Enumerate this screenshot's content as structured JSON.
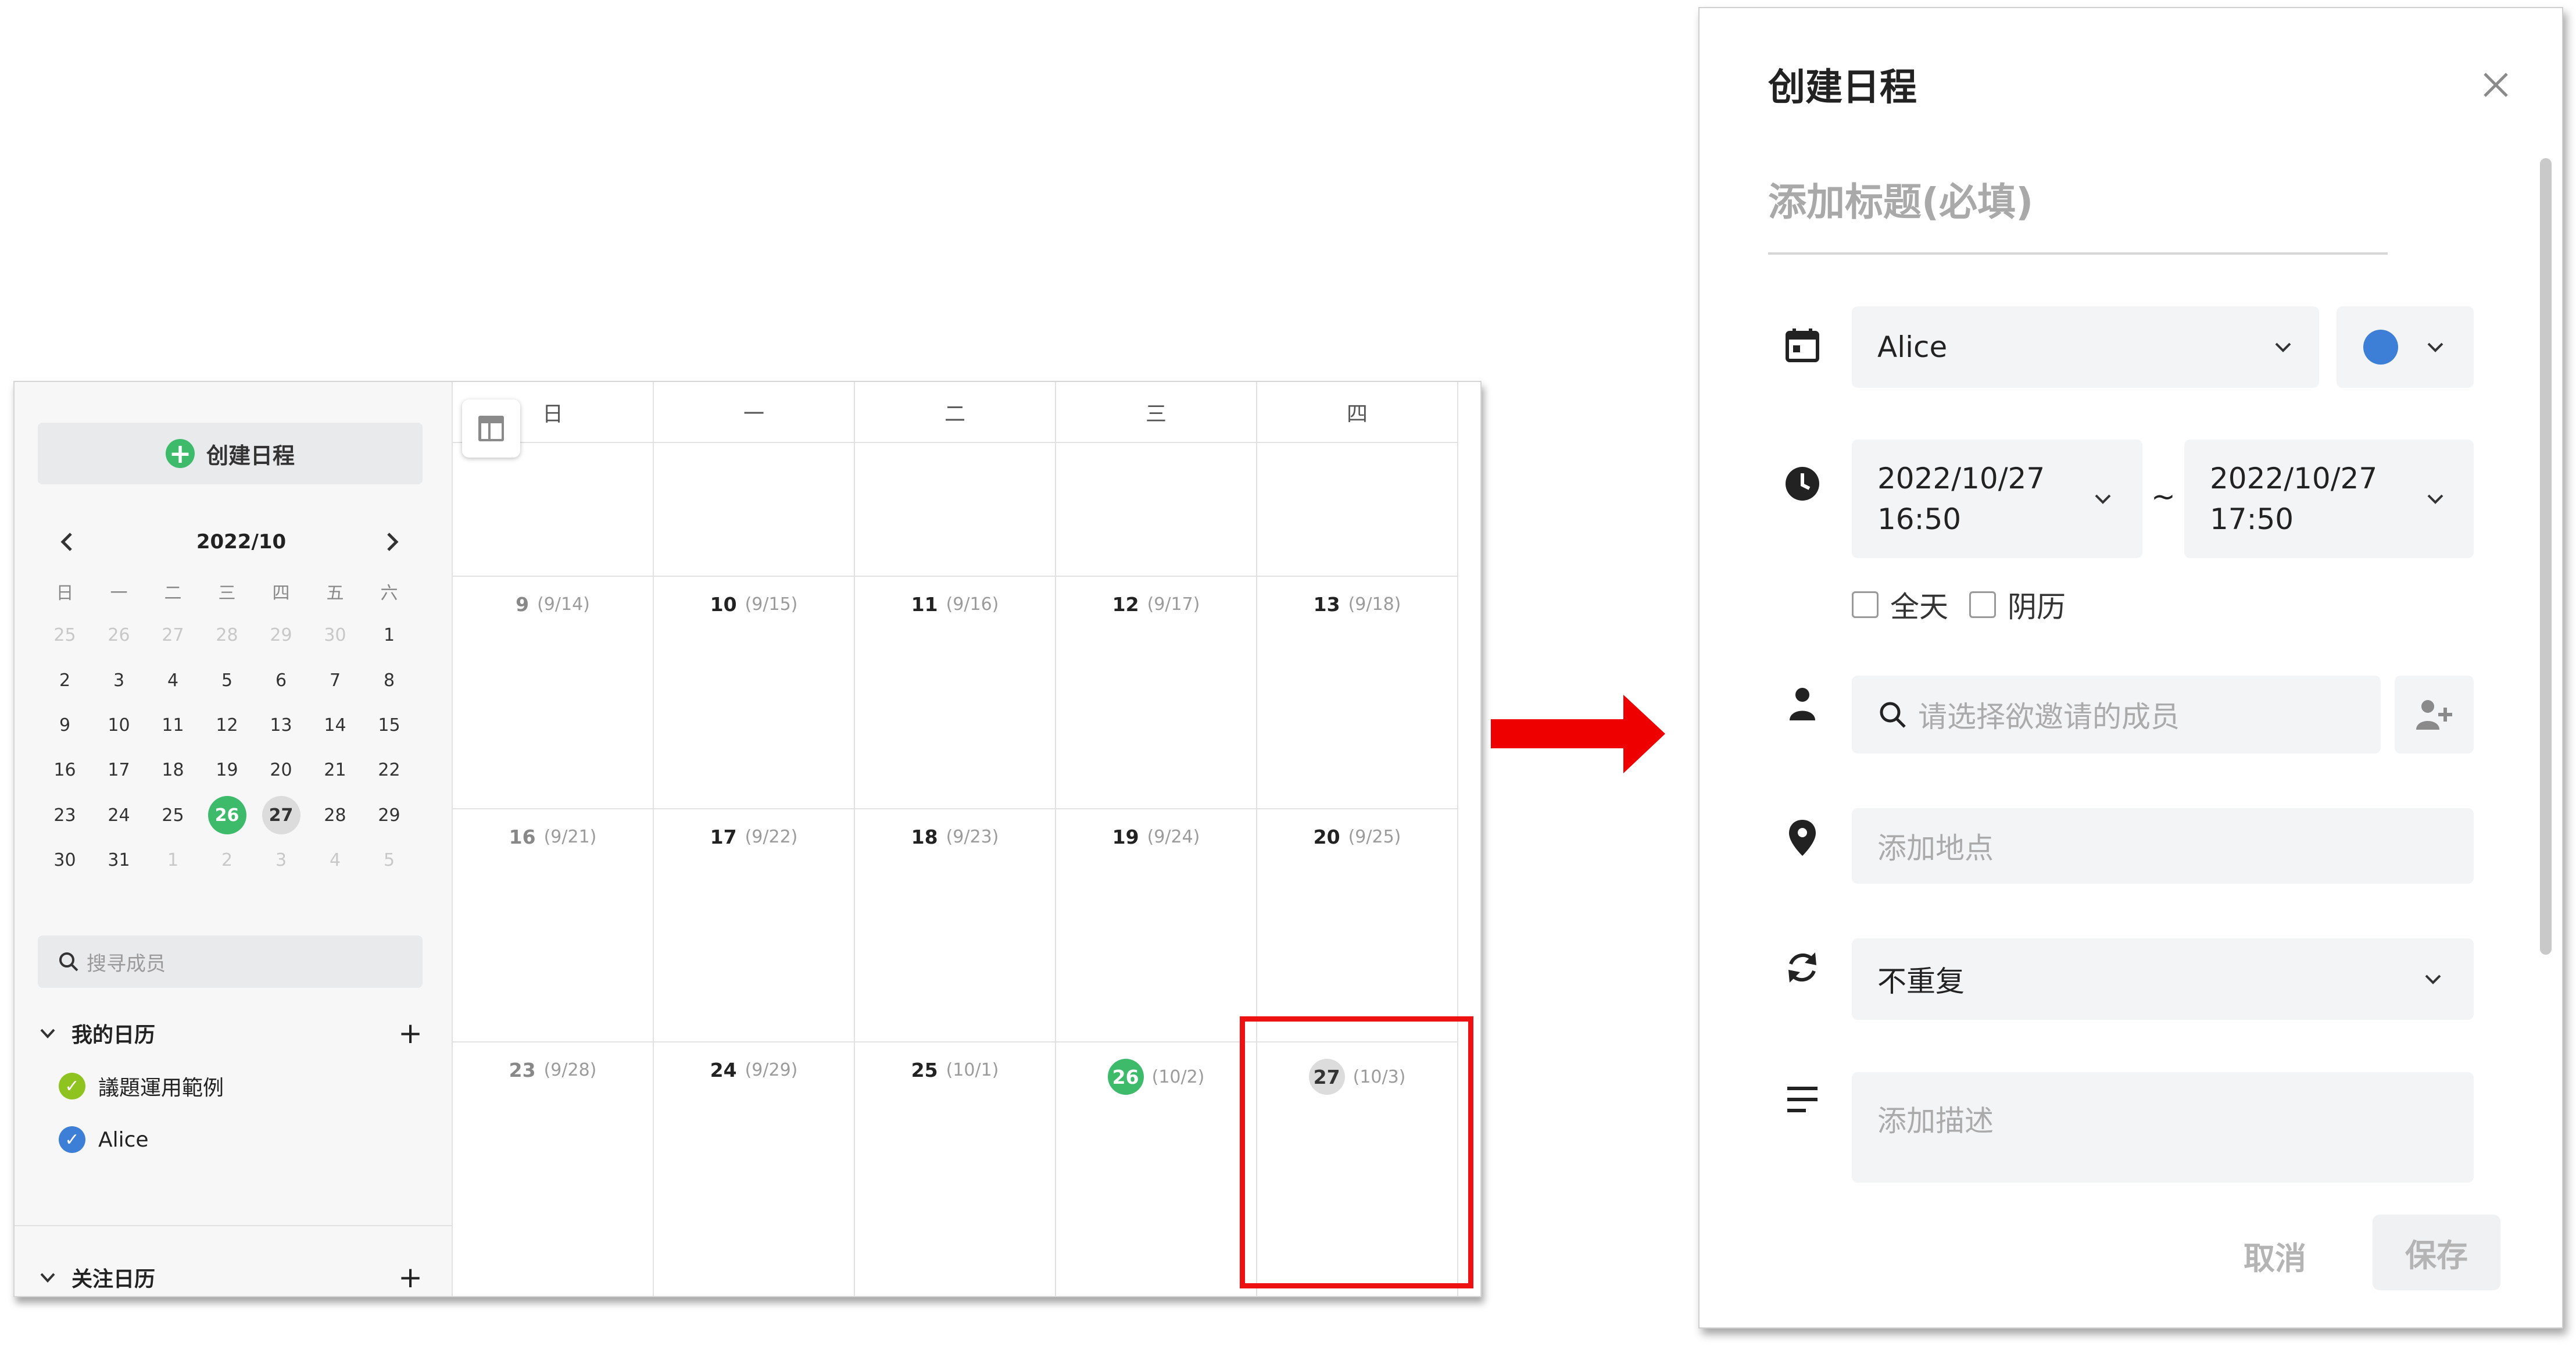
{
  "calendar": {
    "sidebar": {
      "create_button": "创建日程",
      "month_label": "2022/10",
      "weekdays": [
        "日",
        "一",
        "二",
        "三",
        "四",
        "五",
        "六"
      ],
      "mini_rows": [
        [
          "25",
          "26",
          "27",
          "28",
          "29",
          "30",
          "1"
        ],
        [
          "2",
          "3",
          "4",
          "5",
          "6",
          "7",
          "8"
        ],
        [
          "9",
          "10",
          "11",
          "12",
          "13",
          "14",
          "15"
        ],
        [
          "16",
          "17",
          "18",
          "19",
          "20",
          "21",
          "22"
        ],
        [
          "23",
          "24",
          "25",
          "26",
          "27",
          "28",
          "29"
        ],
        [
          "30",
          "31",
          "1",
          "2",
          "3",
          "4",
          "5"
        ]
      ],
      "today": "26",
      "selected": "27",
      "member_search_placeholder": "搜寻成员",
      "my_calendars_label": "我的日历",
      "my_calendars": [
        {
          "name": "議題運用範例",
          "color": "#8fc31f"
        },
        {
          "name": "Alice",
          "color": "#3d7fd6"
        }
      ],
      "follow_calendars_label": "关注日历"
    },
    "grid": {
      "day_headers": [
        "日",
        "一",
        "二",
        "三",
        "四"
      ],
      "weeks": [
        [
          {
            "day": "",
            "lunar": ""
          },
          {
            "day": "",
            "lunar": ""
          },
          {
            "day": "",
            "lunar": ""
          },
          {
            "day": "",
            "lunar": ""
          },
          {
            "day": "",
            "lunar": ""
          }
        ],
        [
          {
            "day": "9",
            "lunar": "(9/14)"
          },
          {
            "day": "10",
            "lunar": "(9/15)"
          },
          {
            "day": "11",
            "lunar": "(9/16)"
          },
          {
            "day": "12",
            "lunar": "(9/17)"
          },
          {
            "day": "13",
            "lunar": "(9/18)"
          }
        ],
        [
          {
            "day": "16",
            "lunar": "(9/21)"
          },
          {
            "day": "17",
            "lunar": "(9/22)"
          },
          {
            "day": "18",
            "lunar": "(9/23)"
          },
          {
            "day": "19",
            "lunar": "(9/24)"
          },
          {
            "day": "20",
            "lunar": "(9/25)"
          }
        ],
        [
          {
            "day": "23",
            "lunar": "(9/28)"
          },
          {
            "day": "24",
            "lunar": "(9/29)"
          },
          {
            "day": "25",
            "lunar": "(10/1)"
          },
          {
            "day": "26",
            "lunar": "(10/2)",
            "state": "today"
          },
          {
            "day": "27",
            "lunar": "(10/3)",
            "state": "selected"
          }
        ]
      ]
    }
  },
  "dialog": {
    "title": "创建日程",
    "title_placeholder": "添加标题(必填)",
    "calendar_select": "Alice",
    "calendar_color": "#3d7fd6",
    "start_date": "2022/10/27",
    "start_time": "16:50",
    "range_separator": "~",
    "end_date": "2022/10/27",
    "end_time": "17:50",
    "all_day_label": "全天",
    "lunar_label": "阴历",
    "invite_placeholder": "请选择欲邀请的成员",
    "location_placeholder": "添加地点",
    "repeat_value": "不重复",
    "description_placeholder": "添加描述",
    "cancel_label": "取消",
    "save_label": "保存"
  },
  "colors": {
    "green": "#3dbb6b",
    "highlight_red": "#ee1111",
    "blue": "#3d7fd6"
  }
}
